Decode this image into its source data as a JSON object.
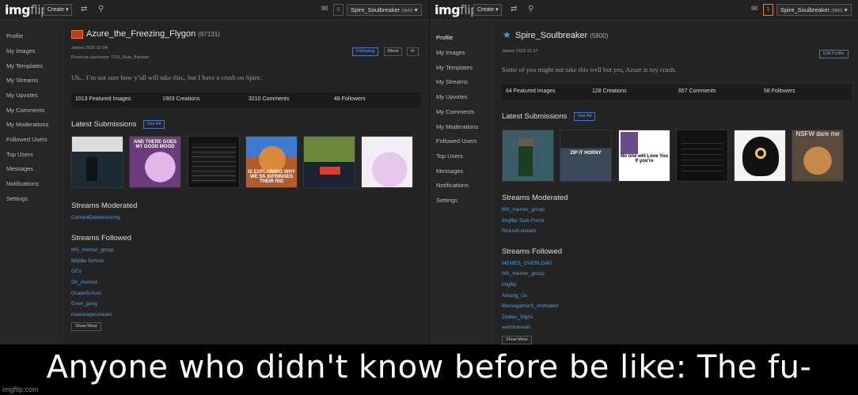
{
  "left": {
    "topbar": {
      "logo_main": "img",
      "logo_sub": "flip",
      "create_label": "Create ▾",
      "notif_count": "0",
      "user_label": "Spire_Soulbreaker",
      "user_points": "(5800)"
    },
    "nav": [
      "Profile",
      "My Images",
      "My Templates",
      "My Streams",
      "My Upvotes",
      "My Comments",
      "My Moderations",
      "Followed Users",
      "Top Users",
      "Messages",
      "Notifications",
      "Settings"
    ],
    "profile": {
      "username": "Azure_the_Freezing_Flygon",
      "points": "(97131)",
      "joined": "Joined 2020-10-04",
      "previous": "Previous username: TOS_Rule_Breaker",
      "following_label": "Following",
      "block_label": "Block",
      "bio": "Uh... I’m not sure how y’all will take this.. but I have a crush on Spire.",
      "stats": [
        "1013 Featured Images",
        "1903 Creations",
        "3210 Comments",
        "48 Followers"
      ],
      "latest_title": "Latest Submissions",
      "see_all": "See All",
      "thumbs": [
        "",
        "AND THERE GOES MY GOOD MOOD",
        "",
        "IS EXPLAINING WHY WE SK INFRINGES THEIR RIG",
        "",
        ""
      ],
      "moderated_title": "Streams Moderated",
      "moderated": [
        "ContentDeletersArmy"
      ],
      "followed_title": "Streams Followed",
      "followed": [
        "MS_memer_group",
        "Middle School",
        "OCs",
        "Oc_memez",
        "GradeSchool",
        "Evee_gang",
        "masonepicstream"
      ],
      "show_more": "Show More"
    }
  },
  "right": {
    "topbar": {
      "logo_main": "img",
      "logo_sub": "flip",
      "create_label": "Create ▾",
      "notif_count": "1",
      "user_label": "Spire_Soulbreaker",
      "user_points": "(5800)"
    },
    "nav": [
      "Profile",
      "My Images",
      "My Templates",
      "My Streams",
      "My Upvotes",
      "My Comments",
      "My Moderations",
      "Followed Users",
      "Top Users",
      "Messages",
      "Notifications",
      "Settings"
    ],
    "profile": {
      "username": "Spire_Soulbreaker",
      "points": "(5800)",
      "joined": "Joined 2020-11-17",
      "edit_label": "Edit Profile",
      "bio": "Some of you might not take this well but yes, Azure is my crush.",
      "stats": [
        "64 Featured Images",
        "128 Creations",
        "657 Comments",
        "58 Followers"
      ],
      "latest_title": "Latest Submissions",
      "see_all": "See All",
      "thumbs": [
        "",
        "ZIP IT HORNY",
        "No one will Love You  If you're",
        "",
        "",
        "NSFW dare me"
      ],
      "moderated_title": "Streams Moderated",
      "moderated": [
        "MS_memer_group",
        "Imgflip-Task-Force",
        "Rickroll-stream"
      ],
      "followed_title": "Streams Followed",
      "followed": [
        "MEMES_OVERLOAD",
        "MS_memer_group",
        "imgflip",
        "Among_Us",
        "Memegamer3_Animated",
        "Zodiac_Signs",
        "weirdcereals"
      ],
      "show_more": "Show More"
    }
  },
  "caption": {
    "text": "Anyone who didn't know before be like: The fu-",
    "watermark": "imgflip.com"
  },
  "colors": {
    "accent": "#4aa3df",
    "background": "#242424",
    "caption_bg": "#000000"
  }
}
